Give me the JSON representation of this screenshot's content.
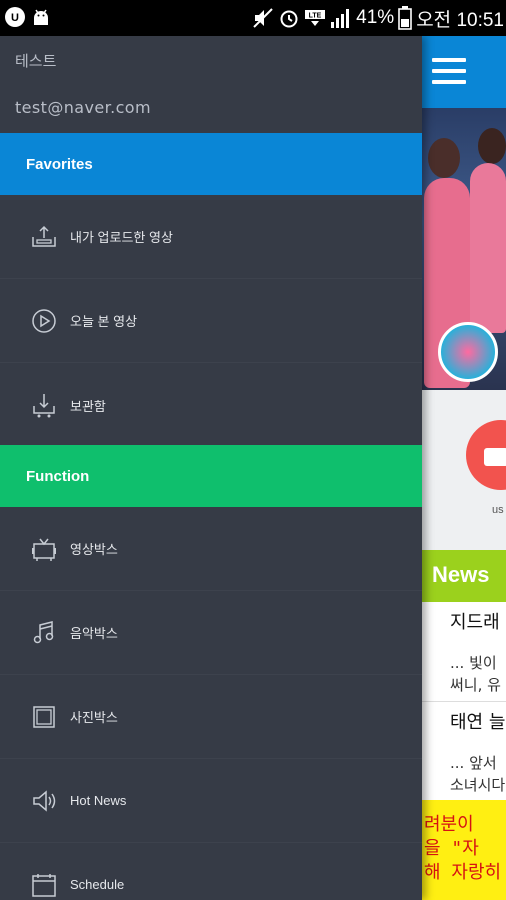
{
  "status_bar": {
    "battery": "41%",
    "time": "오전 10:51"
  },
  "drawer": {
    "user_name": "테스트",
    "user_email": "test@naver.com",
    "favorites": {
      "title": "Favorites",
      "items": [
        {
          "label": "내가 업로드한 영상",
          "icon": "upload-icon"
        },
        {
          "label": "오늘 본 영상",
          "icon": "play-circle-icon"
        },
        {
          "label": "보관함",
          "icon": "archive-download-icon"
        }
      ]
    },
    "function": {
      "title": "Function",
      "items": [
        {
          "label": "영상박스",
          "icon": "tv-icon"
        },
        {
          "label": "음악박스",
          "icon": "music-note-icon"
        },
        {
          "label": "사진박스",
          "icon": "photo-frame-icon"
        },
        {
          "label": "Hot News",
          "icon": "speaker-icon"
        },
        {
          "label": "Schedule",
          "icon": "calendar-icon"
        }
      ]
    }
  },
  "background_app": {
    "toolbar_color": "#0a86d6",
    "camera_label": "us",
    "news_title": "News",
    "news": [
      {
        "title": "지드래",
        "line1": "... 빛이",
        "line2": "써니, 유"
      },
      {
        "title": "태연 늘",
        "line1": "... 앞서",
        "line2": "소녀시다"
      }
    ],
    "promo_lines": [
      "려분이",
      "을 \"자",
      "해 자랑히"
    ]
  },
  "colors": {
    "drawer_bg": "#363b46",
    "favorites_bg": "#0a86d6",
    "function_bg": "#0fbf6d",
    "news_bg": "#9bd11d",
    "promo_bg": "#ffef12"
  }
}
